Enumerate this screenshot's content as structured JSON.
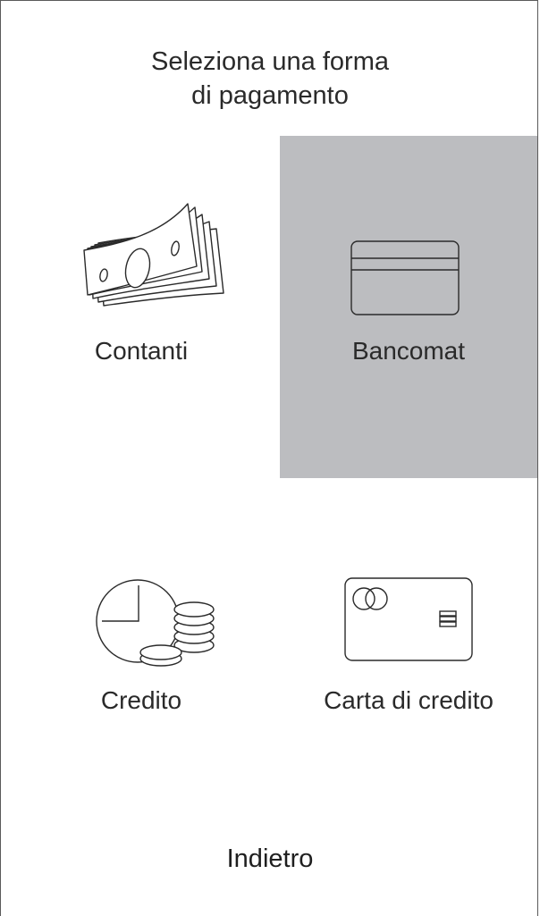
{
  "header": {
    "title_line1": "Seleziona una forma",
    "title_line2": "di pagamento"
  },
  "payment_options": [
    {
      "label": "Contanti",
      "icon": "cash-icon",
      "selected": false
    },
    {
      "label": "Bancomat",
      "icon": "debit-card-icon",
      "selected": true
    },
    {
      "label": "Credito",
      "icon": "credit-clock-coins-icon",
      "selected": false
    },
    {
      "label": "Carta di credito",
      "icon": "credit-card-icon",
      "selected": false
    }
  ],
  "footer": {
    "back_label": "Indietro"
  },
  "colors": {
    "selected_tile": "#bcbdc0",
    "text": "#2a2a2a",
    "icon_stroke": "#2a2a2a",
    "frame": "#5a5a5a"
  }
}
